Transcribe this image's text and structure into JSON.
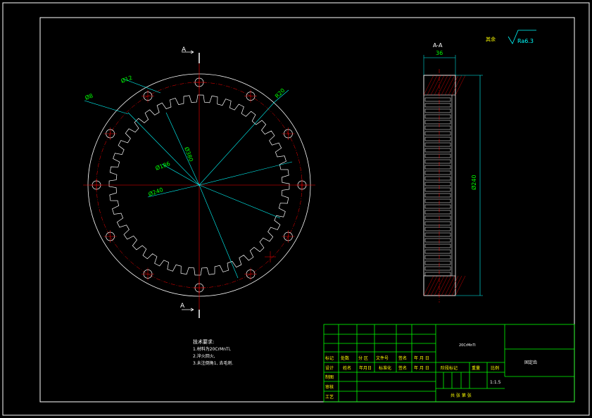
{
  "section": {
    "top_label": "A",
    "bottom_label": "A",
    "view_label": "A-A"
  },
  "roughness": {
    "prefix": "其余",
    "value": "Ra6.3"
  },
  "dims": {
    "hole_dia": "Ø12",
    "edge_dim": "Ø8",
    "radius": "R20",
    "pitch_circle": "Ø380",
    "inner_dia": "Ø186",
    "outer_dia": "Ø240",
    "width": "36",
    "height_dia": "Ø240"
  },
  "notes": {
    "title": "技术要求:",
    "lines": [
      "1.材料为20CrMnTi,",
      "2.淬火回火,",
      "3.未注倒角1, 去毛刺."
    ]
  },
  "title_block": {
    "header_cells": [
      "标记",
      "处数",
      "分 区",
      "文件号",
      "签名",
      "年 月 日"
    ],
    "row_design": [
      "设计",
      "姓名",
      "年月日",
      "标准化",
      "签名",
      "年 月 日"
    ],
    "row_labels": [
      "制图",
      "审核",
      "工艺"
    ],
    "stage_header": [
      "阶段标记",
      "重量",
      "比例"
    ],
    "scale": "1:1.5",
    "sheets": "共 张 第 张",
    "material": "20CrMnTi",
    "part_name": "固定齿"
  },
  "colors": {
    "frame": "#ffffff",
    "geometry": "#ffffff",
    "centerline": "#ff0000",
    "dimension": "#00ffff",
    "text": "#ffff00",
    "title_block": "#00ff00"
  }
}
